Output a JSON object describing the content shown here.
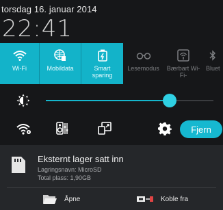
{
  "status": {
    "date": "torsdag 16. januar 2014",
    "time": "22:41"
  },
  "quick_settings": [
    {
      "label": "Wi-Fi",
      "icon": "wifi-icon",
      "active": true
    },
    {
      "label": "Mobildata",
      "icon": "mobile-data-icon",
      "active": true
    },
    {
      "label": "Smart sparing",
      "icon": "smart-saving-icon",
      "active": true
    },
    {
      "label": "Lesemodus",
      "icon": "reading-mode-icon",
      "active": false
    },
    {
      "label": "Bærbart Wi-Fi-",
      "icon": "hotspot-icon",
      "active": false
    },
    {
      "label": "Bluet",
      "icon": "bluetooth-icon",
      "active": false
    }
  ],
  "brightness": {
    "level": 0.74,
    "icon": "brightness-icon"
  },
  "actions": {
    "icons": [
      "wifi-settings-icon",
      "audio-settings-icon",
      "screen-mirror-icon",
      "settings-gear-icon"
    ],
    "clear_label": "Fjern"
  },
  "notification": {
    "title": "Eksternt lager satt inn",
    "line1": "Lagringsnavn: MicroSD",
    "line2": "Total plass: 1,90GB",
    "open_label": "Åpne",
    "disconnect_label": "Koble fra",
    "icon": "sd-card-icon"
  },
  "colors": {
    "accent": "#13b3c9",
    "background": "#161719",
    "notification_bg": "#25272a"
  }
}
